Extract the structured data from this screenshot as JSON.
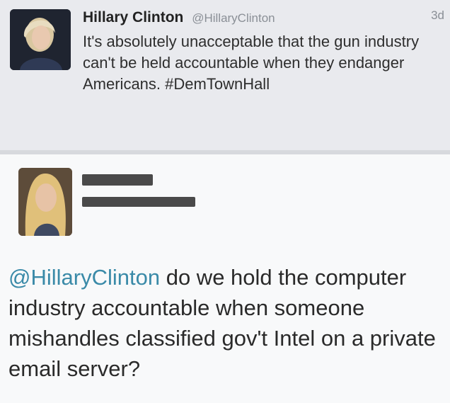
{
  "top_tweet": {
    "name": "Hillary Clinton",
    "handle": "@HillaryClinton",
    "time": "3d",
    "text": "It's absolutely unacceptable that the gun industry can't be held accountable when they endanger Americans. #DemTownHall"
  },
  "reply_tweet": {
    "mention": "@HillaryClinton",
    "text": " do we hold the computer industry accountable when someone mishandles classified gov't Intel on a private email server?"
  },
  "colors": {
    "mention": "#3a8aa8",
    "redaction": "#4a4a4a"
  }
}
